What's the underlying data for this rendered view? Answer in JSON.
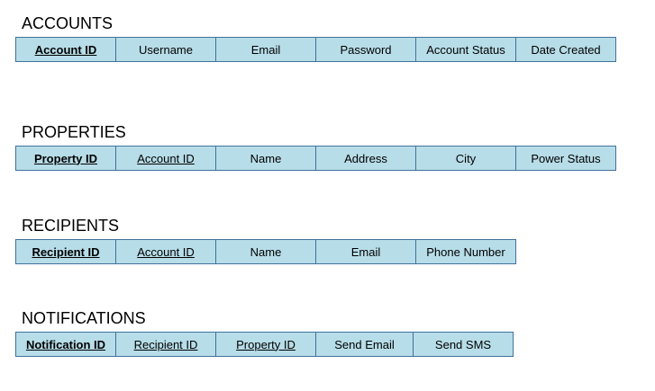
{
  "tables": [
    {
      "title": "ACCOUNTS",
      "fields": [
        {
          "label": "Account ID",
          "key": "pk"
        },
        {
          "label": "Username",
          "key": ""
        },
        {
          "label": "Email",
          "key": ""
        },
        {
          "label": "Password",
          "key": ""
        },
        {
          "label": "Account Status",
          "key": ""
        },
        {
          "label": "Date Created",
          "key": ""
        }
      ]
    },
    {
      "title": "PROPERTIES",
      "fields": [
        {
          "label": "Property ID",
          "key": "pk"
        },
        {
          "label": "Account ID",
          "key": "fk"
        },
        {
          "label": "Name",
          "key": ""
        },
        {
          "label": "Address",
          "key": ""
        },
        {
          "label": "City",
          "key": ""
        },
        {
          "label": "Power Status",
          "key": ""
        }
      ]
    },
    {
      "title": "RECIPIENTS",
      "fields": [
        {
          "label": "Recipient ID",
          "key": "pk"
        },
        {
          "label": "Account ID",
          "key": "fk"
        },
        {
          "label": "Name",
          "key": ""
        },
        {
          "label": "Email",
          "key": ""
        },
        {
          "label": "Phone Number",
          "key": ""
        }
      ]
    },
    {
      "title": "NOTIFICATIONS",
      "fields": [
        {
          "label": "Notification ID",
          "key": "pk"
        },
        {
          "label": "Recipient ID",
          "key": "fk"
        },
        {
          "label": "Property ID",
          "key": "fk"
        },
        {
          "label": "Send Email",
          "key": ""
        },
        {
          "label": "Send SMS",
          "key": ""
        }
      ]
    }
  ],
  "colors": {
    "cell_fill": "#b7dde8",
    "cell_border": "#41719c",
    "text": "#000000"
  }
}
